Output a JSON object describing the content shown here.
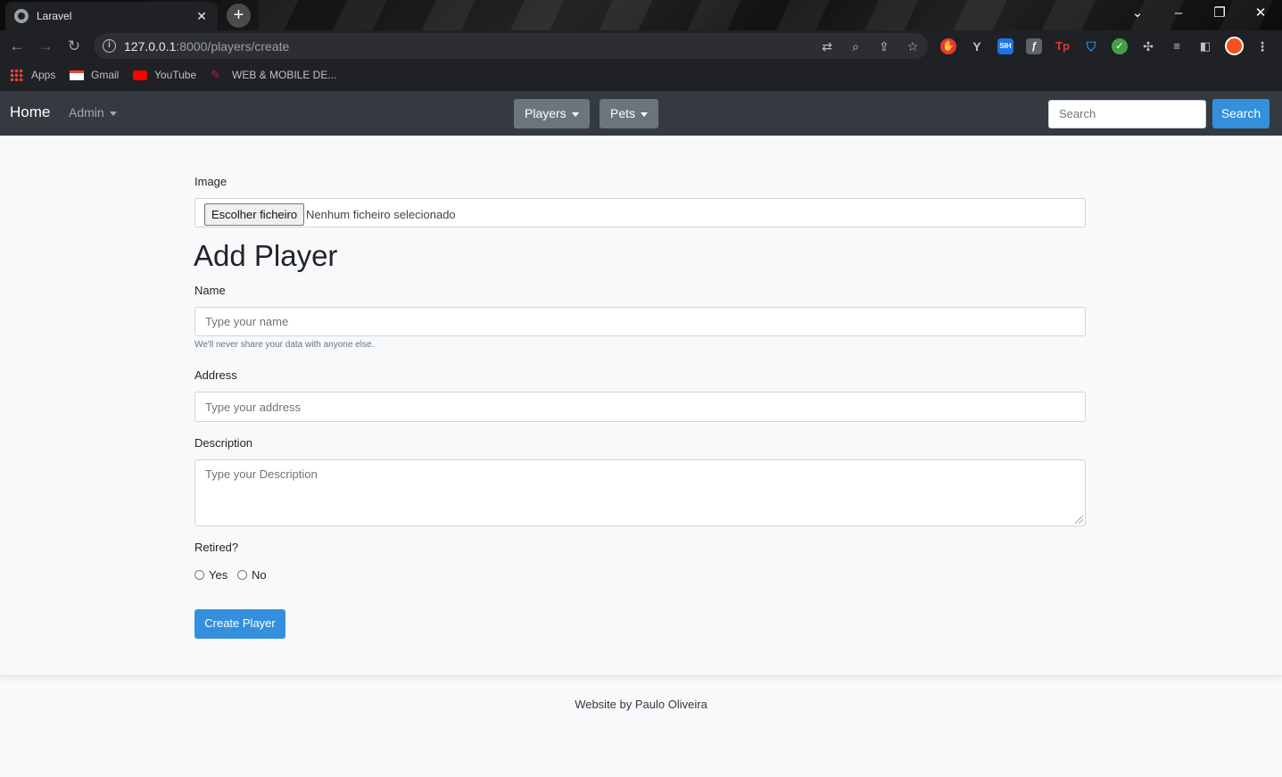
{
  "browser": {
    "tab_title": "Laravel",
    "tab_close": "✕",
    "new_tab": "+",
    "url_host": "127.0.0.1",
    "url_rest": ":8000/players/create",
    "bookmarks": [
      {
        "label": "Apps",
        "icon": "apps-grid-icon"
      },
      {
        "label": "Gmail",
        "icon": "gmail-icon"
      },
      {
        "label": "YouTube",
        "icon": "youtube-icon"
      },
      {
        "label": "WEB & MOBILE DE...",
        "icon": "feather-icon"
      }
    ]
  },
  "navbar": {
    "brand": "Home",
    "admin": "Admin",
    "players": "Players",
    "pets": "Pets",
    "search_placeholder": "Search",
    "search_button": "Search",
    "color": "#343a40"
  },
  "form": {
    "image_label": "Image",
    "file_button": "Escolher ficheiro",
    "file_status": "Nenhum ficheiro selecionado",
    "title": "Add Player",
    "name_label": "Name",
    "name_placeholder": "Type your name",
    "name_help": "We'll never share your data with anyone else.",
    "address_label": "Address",
    "address_placeholder": "Type your address",
    "description_label": "Description",
    "description_placeholder": "Type your Description",
    "retired_label": "Retired?",
    "retired_yes": "Yes",
    "retired_no": "No",
    "submit": "Create Player",
    "accent": "#3490dc"
  },
  "footer": {
    "text": "Website by Paulo Oliveira"
  }
}
